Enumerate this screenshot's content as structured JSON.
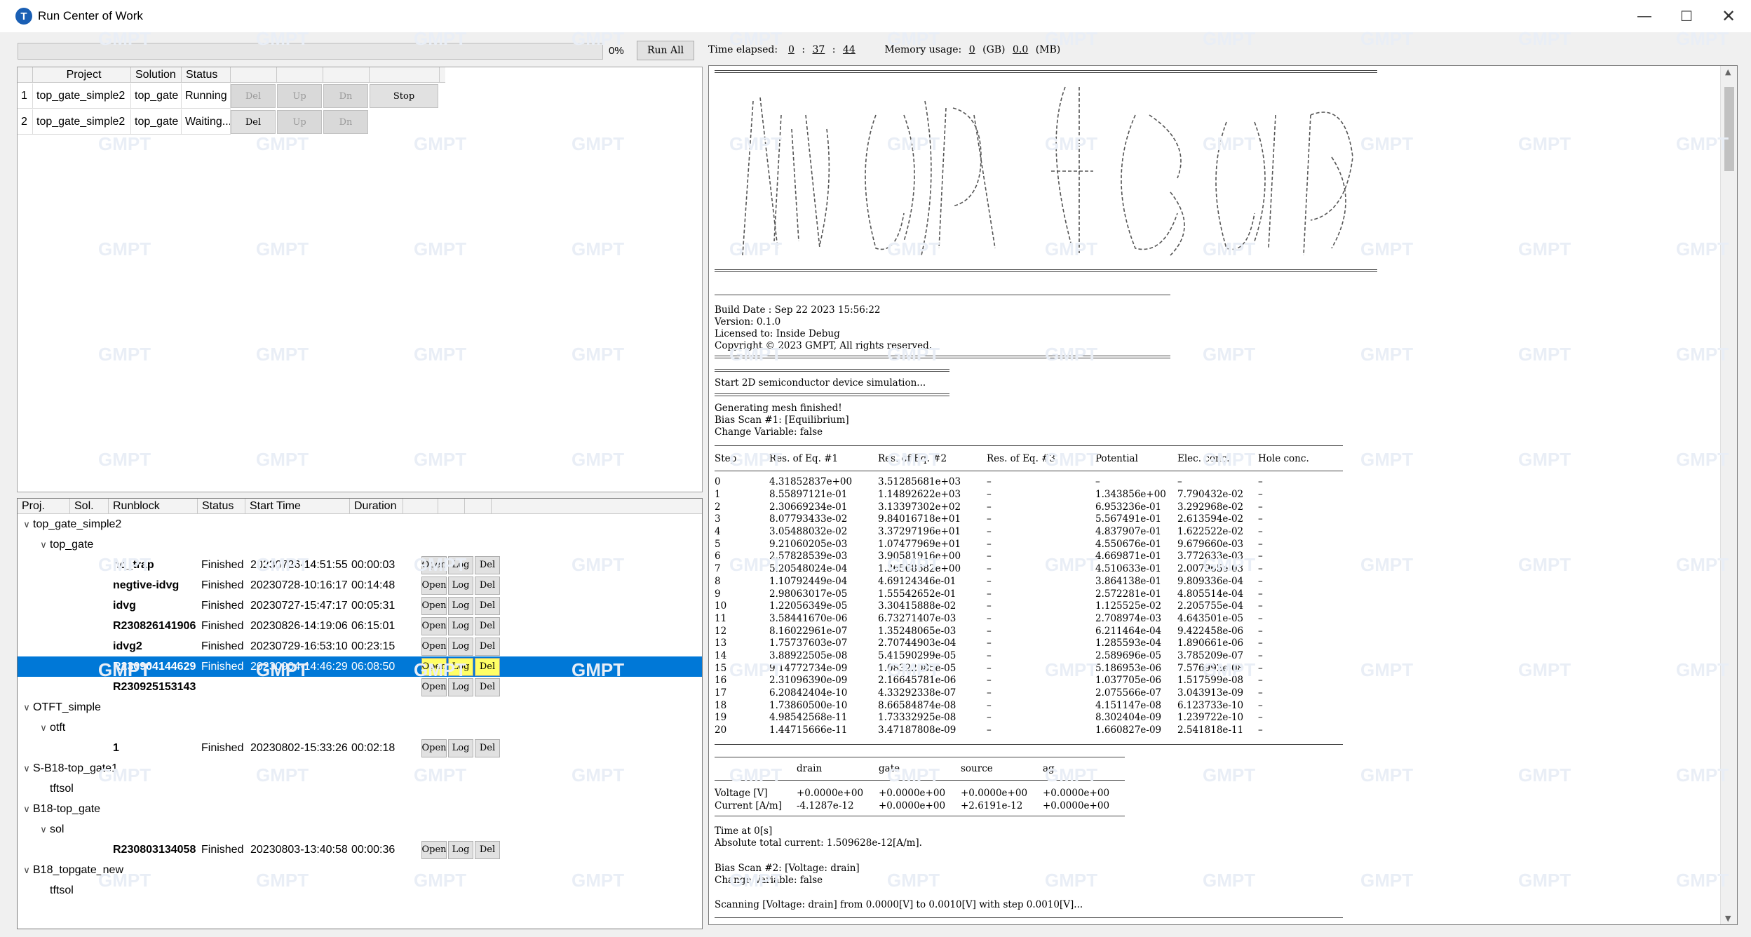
{
  "window": {
    "title": "Run Center of Work",
    "app_icon": "T"
  },
  "toolbar": {
    "progress_pct": "0%",
    "progress_value": 0,
    "run_all": "Run All",
    "time_label": "Time elapsed:",
    "time_h": "0",
    "time_m": "37",
    "time_s": "44",
    "sep": ":",
    "mem_label": "Memory usage:",
    "mem_gb": "0",
    "gb_unit": "(GB)",
    "mem_mb": "0.0",
    "mb_unit": "(MB)"
  },
  "jobs": {
    "headers": [
      "Project",
      "Solution",
      "Status"
    ],
    "rows": [
      {
        "idx": "1",
        "project": "top_gate_simple2",
        "solution": "top_gate",
        "status": "Running",
        "del": "Del",
        "up": "Up",
        "dn": "Dn",
        "stop": "Stop"
      },
      {
        "idx": "2",
        "project": "top_gate_simple2",
        "solution": "top_gate",
        "status": "Waiting...",
        "del": "Del",
        "up": "Up",
        "dn": "Dn"
      }
    ]
  },
  "tree": {
    "headers": [
      "Proj.",
      "Sol.",
      "Runblock",
      "Status",
      "Start Time",
      "Duration"
    ],
    "buttons": {
      "open": "Open",
      "log": "Log",
      "del": "Del"
    },
    "items": [
      {
        "level": 0,
        "label": "top_gate_simple2",
        "caret": "∨"
      },
      {
        "level": 1,
        "label": "top_gate",
        "caret": "∨"
      },
      {
        "level": 2,
        "label": "no_trap",
        "status": "Finished",
        "start": "20230726-14:51:55",
        "dur": "00:00:03"
      },
      {
        "level": 2,
        "label": "negtive-idvg",
        "status": "Finished",
        "start": "20230728-10:16:17",
        "dur": "00:14:48"
      },
      {
        "level": 2,
        "label": "idvg",
        "status": "Finished",
        "start": "20230727-15:47:17",
        "dur": "00:05:31"
      },
      {
        "level": 2,
        "label": "R230826141906",
        "status": "Finished",
        "start": "20230826-14:19:06",
        "dur": "06:15:01"
      },
      {
        "level": 2,
        "label": "idvg2",
        "status": "Finished",
        "start": "20230729-16:53:10",
        "dur": "00:23:15"
      },
      {
        "level": 2,
        "label": "R230904144629",
        "status": "Finished",
        "start": "20230904-14:46:29",
        "dur": "06:08:50",
        "selected": true
      },
      {
        "level": 2,
        "label": "R230925153143",
        "status": "",
        "start": "",
        "dur": ""
      },
      {
        "level": 0,
        "label": "OTFT_simple",
        "caret": "∨"
      },
      {
        "level": 1,
        "label": "otft",
        "caret": "∨"
      },
      {
        "level": 2,
        "label": "1",
        "status": "Finished",
        "start": "20230802-15:33:26",
        "dur": "00:02:18"
      },
      {
        "level": 0,
        "label": "S-B18-top_gate1",
        "caret": "∨"
      },
      {
        "level": 1,
        "label": "tftsol"
      },
      {
        "level": 0,
        "label": "B18-top_gate",
        "caret": "∨"
      },
      {
        "level": 1,
        "label": "sol",
        "caret": "∨"
      },
      {
        "level": 2,
        "label": "R230803134058",
        "status": "Finished",
        "start": "20230803-13:40:58",
        "dur": "00:00:36"
      },
      {
        "level": 0,
        "label": "B18_topgate_new",
        "caret": "∨"
      },
      {
        "level": 1,
        "label": "tftsol"
      }
    ]
  },
  "console": {
    "build": "Build Date : Sep 22 2023 15:56:22",
    "version": "Version: 0.1.0",
    "license": "Licensed to: Inside Debug",
    "copyright": "Copyright © 2023 GMPT, All rights reserved.",
    "start": "Start 2D semiconductor device simulation...",
    "mesh": "Generating mesh finished!",
    "bias1": "Bias Scan #1: [Equilibrium]",
    "chg1": "Change Variable: false",
    "res_headers": [
      "Step",
      "Res. of Eq. #1",
      "Res. of Eq. #2",
      "Res. of Eq. #3",
      "Potential",
      "Elec. conc.",
      "Hole conc."
    ],
    "res_rows": [
      [
        "0",
        "4.31852837e+00",
        "3.51285681e+03",
        "–",
        "–",
        "–",
        "–"
      ],
      [
        "1",
        "8.55897121e-01",
        "1.14892622e+03",
        "–",
        "1.343856e+00",
        "7.790432e-02",
        "–"
      ],
      [
        "2",
        "2.30669234e-01",
        "3.13397302e+02",
        "–",
        "6.953236e-01",
        "3.292968e-02",
        "–"
      ],
      [
        "3",
        "8.07793433e-02",
        "9.84016718e+01",
        "–",
        "5.567491e-01",
        "2.613594e-02",
        "–"
      ],
      [
        "4",
        "3.05488032e-02",
        "3.37297196e+01",
        "–",
        "4.837907e-01",
        "1.622522e-02",
        "–"
      ],
      [
        "5",
        "9.21060205e-03",
        "1.07477969e+01",
        "–",
        "4.550676e-01",
        "9.679660e-03",
        "–"
      ],
      [
        "6",
        "2.57828539e-03",
        "3.90581916e+00",
        "–",
        "4.669871e-01",
        "3.772633e-03",
        "–"
      ],
      [
        "7",
        "5.20548024e-04",
        "1.36568682e+00",
        "–",
        "4.510633e-01",
        "2.007965e-03",
        "–"
      ],
      [
        "8",
        "1.10792449e-04",
        "4.69124346e-01",
        "–",
        "3.864138e-01",
        "9.809336e-04",
        "–"
      ],
      [
        "9",
        "2.98063017e-05",
        "1.55542652e-01",
        "–",
        "2.572281e-01",
        "4.805514e-04",
        "–"
      ],
      [
        "10",
        "1.22056349e-05",
        "3.30415888e-02",
        "–",
        "1.125525e-02",
        "2.205755e-04",
        "–"
      ],
      [
        "11",
        "3.58441670e-06",
        "6.73271407e-03",
        "–",
        "2.708974e-03",
        "4.643501e-05",
        "–"
      ],
      [
        "12",
        "8.16022961e-07",
        "1.35248065e-03",
        "–",
        "6.211464e-04",
        "9.422458e-06",
        "–"
      ],
      [
        "13",
        "1.75737603e-07",
        "2.70744903e-04",
        "–",
        "1.285593e-04",
        "1.890661e-06",
        "–"
      ],
      [
        "14",
        "3.88922505e-08",
        "5.41590299e-05",
        "–",
        "2.589696e-05",
        "3.785209e-07",
        "–"
      ],
      [
        "15",
        "9.14772734e-09",
        "1.08322085e-05",
        "–",
        "5.186953e-06",
        "7.576992e-08",
        "–"
      ],
      [
        "16",
        "2.31096390e-09",
        "2.16645781e-06",
        "–",
        "1.037705e-06",
        "1.517599e-08",
        "–"
      ],
      [
        "17",
        "6.20842404e-10",
        "4.33292338e-07",
        "–",
        "2.075566e-07",
        "3.043913e-09",
        "–"
      ],
      [
        "18",
        "1.73860500e-10",
        "8.66584874e-08",
        "–",
        "4.151147e-08",
        "6.123733e-10",
        "–"
      ],
      [
        "19",
        "4.98542568e-11",
        "1.73332925e-08",
        "–",
        "8.302404e-09",
        "1.239722e-10",
        "–"
      ],
      [
        "20",
        "1.44715666e-11",
        "3.47187808e-09",
        "–",
        "1.660827e-09",
        "2.541818e-11",
        "–"
      ]
    ],
    "iv_headers": [
      "",
      "drain",
      "gate",
      "source",
      "ag"
    ],
    "iv_rows": [
      [
        "Voltage [V]",
        "+0.0000e+00",
        "+0.0000e+00",
        "+0.0000e+00",
        "+0.0000e+00"
      ],
      [
        "Current [A/m]",
        "-4.1287e-12",
        "+0.0000e+00",
        "+2.6191e-12",
        "+0.0000e+00"
      ]
    ],
    "time": "Time at 0[s]",
    "abs_current": "Absolute total current: 1.509628e-12[A/m].",
    "bias2": "Bias Scan #2: [Voltage: drain]",
    "chg2": "Change Variable: false",
    "scan": "Scanning [Voltage: drain] from 0.0000[V] to 0.0010[V] with step 0.0010[V]..."
  },
  "watermark": "GMPT"
}
